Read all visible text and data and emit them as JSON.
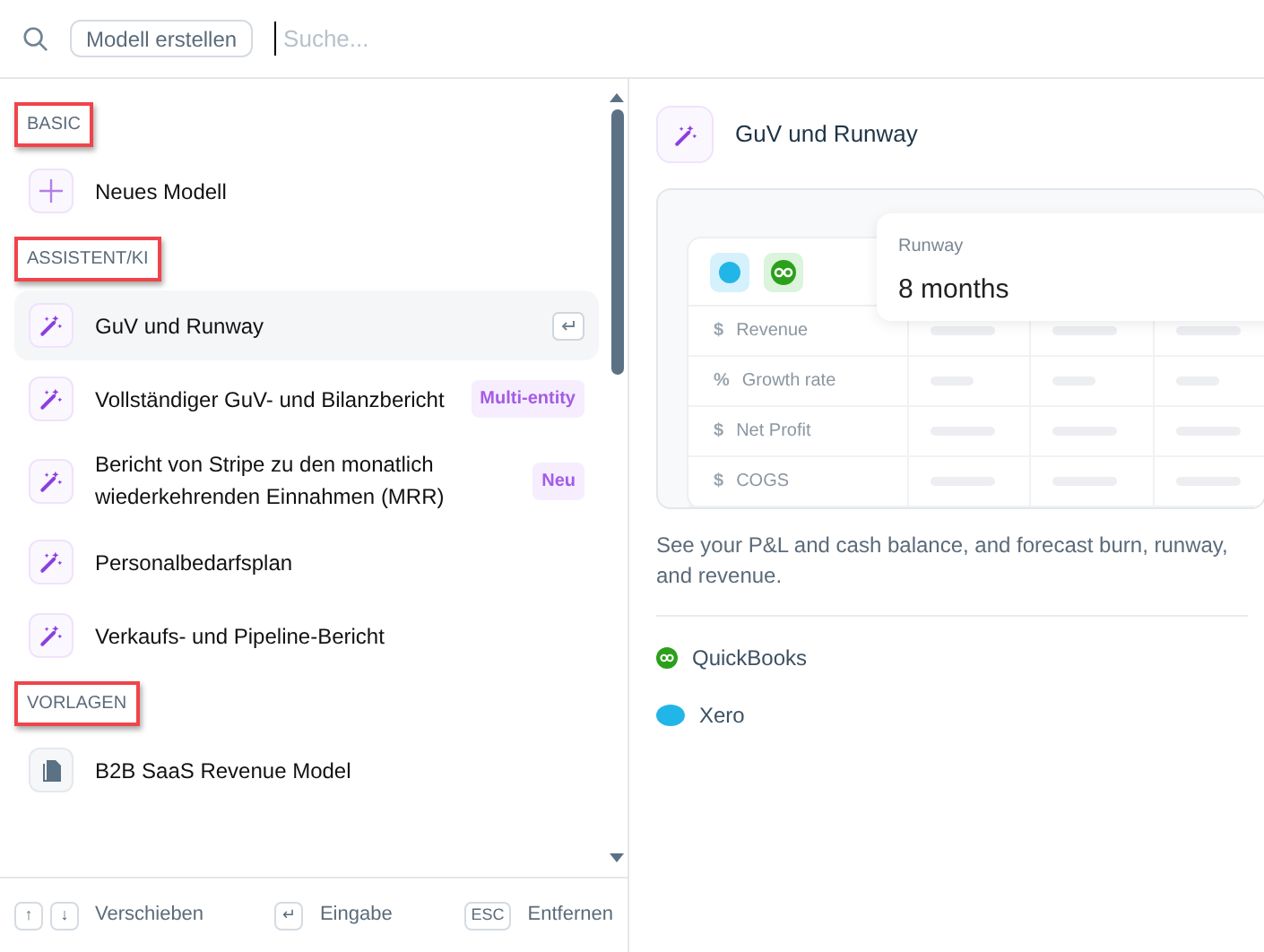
{
  "topbar": {
    "create_button": "Modell erstellen",
    "search": {
      "placeholder": "Suche..."
    }
  },
  "sections": [
    {
      "title": "BASIC",
      "highlighted": true,
      "items": [
        {
          "kind": "plus",
          "label": "Neues Modell",
          "selected": false
        }
      ]
    },
    {
      "title": "ASSISTENT/KI",
      "highlighted": true,
      "items": [
        {
          "kind": "wand",
          "label": "GuV und Runway",
          "selected": true
        },
        {
          "kind": "wand",
          "label": "Vollständiger GuV- und Bilanzbericht",
          "selected": false,
          "badge": "Multi-entity"
        },
        {
          "kind": "wand",
          "label": "Bericht von Stripe zu den monatlich wiederkehrenden Einnahmen (MRR)",
          "selected": false,
          "badge": "Neu"
        },
        {
          "kind": "wand",
          "label": "Personalbedarfsplan",
          "selected": false
        },
        {
          "kind": "wand",
          "label": "Verkaufs- und Pipeline-Bericht",
          "selected": false
        }
      ]
    },
    {
      "title": "VORLAGEN",
      "highlighted": true,
      "items": [
        {
          "kind": "doc",
          "label": "B2B SaaS Revenue Model",
          "selected": false
        }
      ]
    }
  ],
  "footer": [
    {
      "keys": [
        "↑",
        "↓"
      ],
      "label": "Verschieben"
    },
    {
      "keys": [
        "↵"
      ],
      "label": "Eingabe"
    },
    {
      "keys": [
        "ESC"
      ],
      "label": "Entfernen"
    }
  ],
  "detail": {
    "title": "GuV und Runway",
    "preview": {
      "popup_label": "Runway",
      "popup_value": "8 months",
      "rows": [
        {
          "symbol": "$",
          "label": "Revenue"
        },
        {
          "symbol": "%",
          "label": "Growth rate"
        },
        {
          "symbol": "$",
          "label": "Net Profit"
        },
        {
          "symbol": "$",
          "label": "COGS"
        }
      ]
    },
    "description": "See your P&L and cash balance, and forecast burn, runway, and revenue.",
    "integrations": [
      {
        "kind": "quickbooks",
        "name": "QuickBooks"
      },
      {
        "kind": "xero",
        "name": "Xero"
      }
    ]
  }
}
